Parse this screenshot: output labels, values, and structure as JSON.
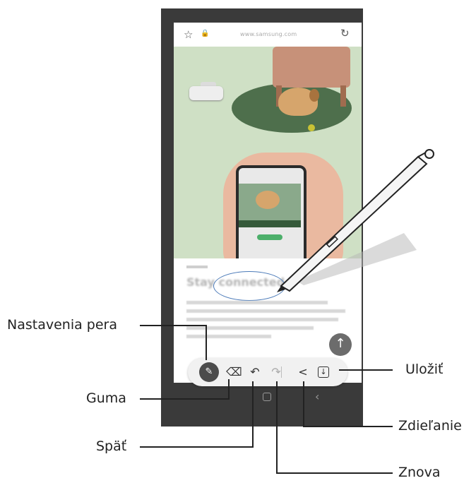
{
  "browser": {
    "url": "www.samsung.com",
    "star_icon": "star-icon",
    "lock_icon": "lock-icon",
    "reload_icon": "reload-icon"
  },
  "article": {
    "title": "Stay connected"
  },
  "toolbar": {
    "items": [
      {
        "name": "pen-settings",
        "icon": "pen-icon"
      },
      {
        "name": "eraser",
        "icon": "eraser-icon"
      },
      {
        "name": "undo",
        "icon": "undo-icon"
      },
      {
        "name": "redo",
        "icon": "redo-icon"
      },
      {
        "name": "share",
        "icon": "share-icon"
      },
      {
        "name": "save",
        "icon": "save-icon"
      }
    ]
  },
  "callouts": {
    "pen_settings": "Nastavenia pera",
    "eraser": "Guma",
    "undo": "Späť",
    "redo": "Znova",
    "share": "Zdieľanie",
    "save": "Uložiť"
  },
  "colors": {
    "accent_circle": "#4b7ab8",
    "toolbar_bg": "#f1f1f1",
    "scene_bg": "#cfe0c5"
  }
}
